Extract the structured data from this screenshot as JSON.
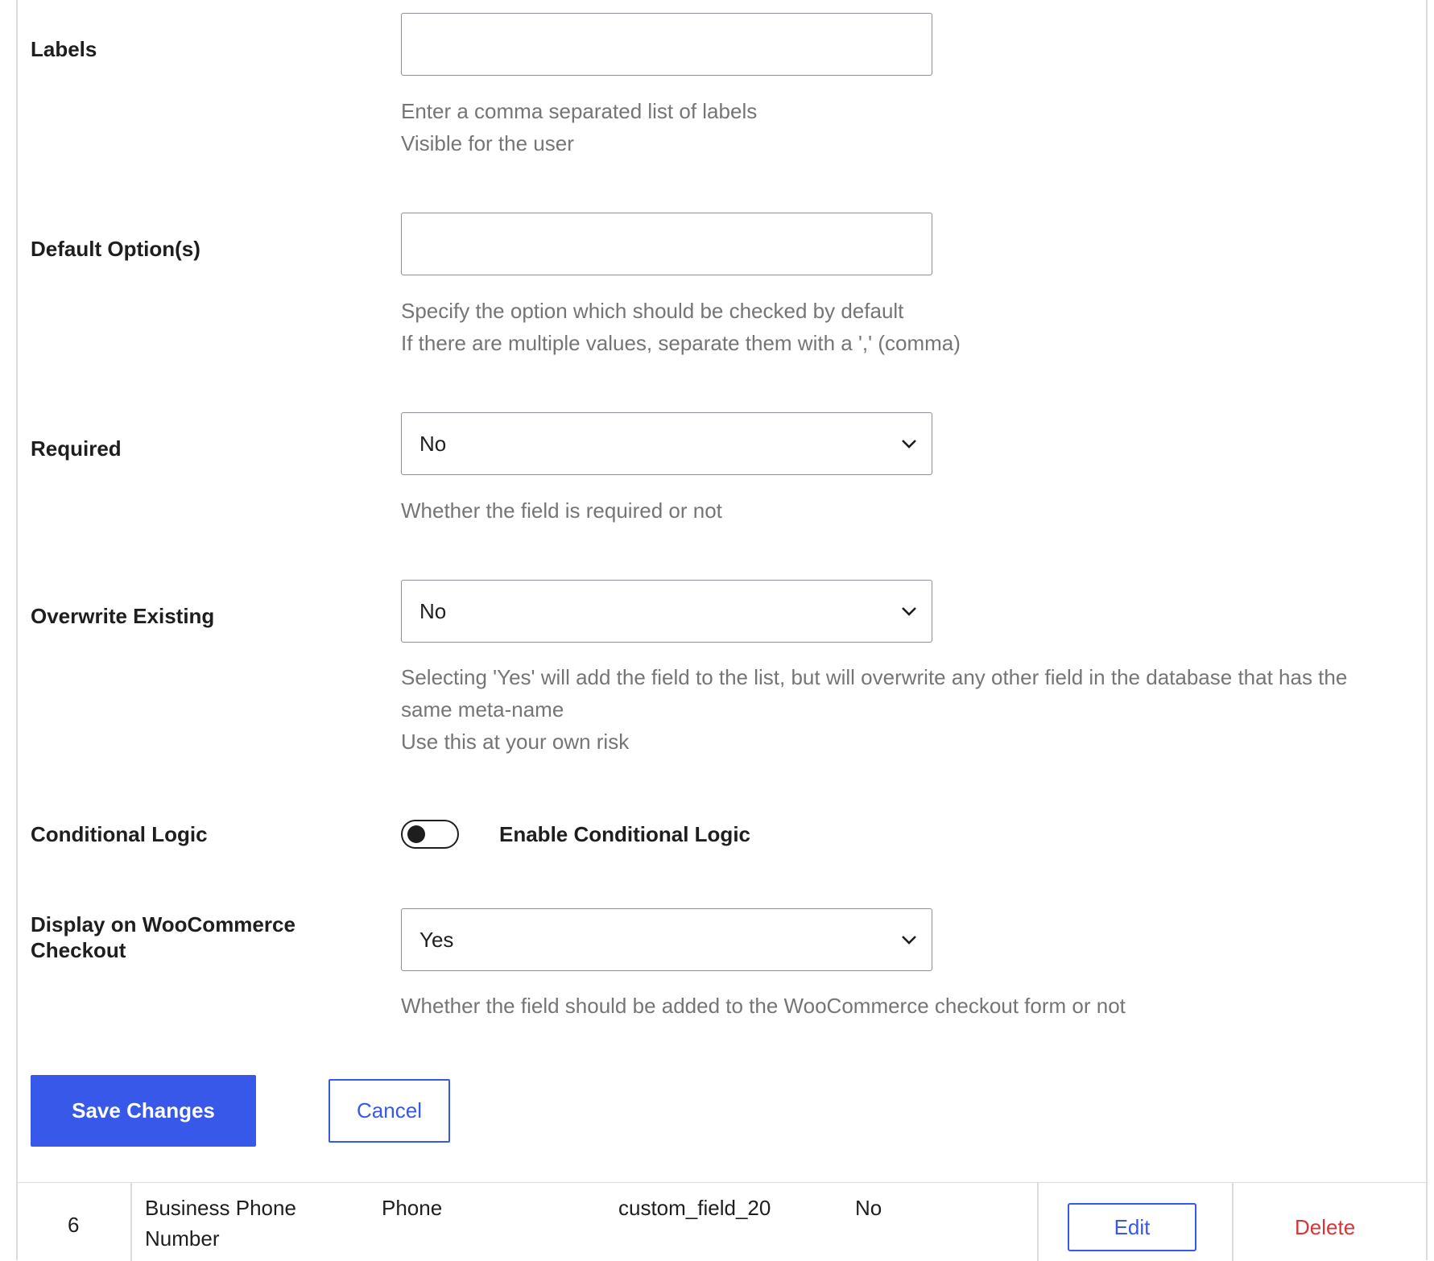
{
  "fields": {
    "labels": {
      "label": "Labels",
      "value": "",
      "help": [
        "Enter a comma separated list of labels",
        "Visible for the user"
      ]
    },
    "default_options": {
      "label": "Default Option(s)",
      "value": "",
      "help": [
        "Specify the option which should be checked by default",
        "If there are multiple values, separate them with a ',' (comma)"
      ]
    },
    "required": {
      "label": "Required",
      "selected": "No",
      "help": [
        "Whether the field is required or not"
      ]
    },
    "overwrite_existing": {
      "label": "Overwrite Existing",
      "selected": "No",
      "help": [
        "Selecting 'Yes' will add the field to the list, but will overwrite any other field in the database that has the",
        "same meta-name",
        "Use this at your own risk"
      ]
    },
    "conditional_logic": {
      "label": "Conditional Logic",
      "toggle_label": "Enable Conditional Logic",
      "enabled": false
    },
    "woocommerce_checkout": {
      "label_line1": "Display on WooCommerce",
      "label_line2": "Checkout",
      "selected": "Yes",
      "help": [
        "Whether the field should be added to the WooCommerce checkout form or not"
      ]
    }
  },
  "actions": {
    "save_label": "Save Changes",
    "cancel_label": "Cancel"
  },
  "table_row": {
    "id": "6",
    "title_line1": "Business Phone",
    "title_line2": "Number",
    "type": "Phone",
    "meta_name": "custom_field_20",
    "required": "No",
    "edit_label": "Edit",
    "delete_label": "Delete"
  },
  "colors": {
    "primary": "#3858e9",
    "danger": "#d63638",
    "help_text": "#757575"
  },
  "icons": {
    "select_arrow": "chevron-down-icon"
  }
}
